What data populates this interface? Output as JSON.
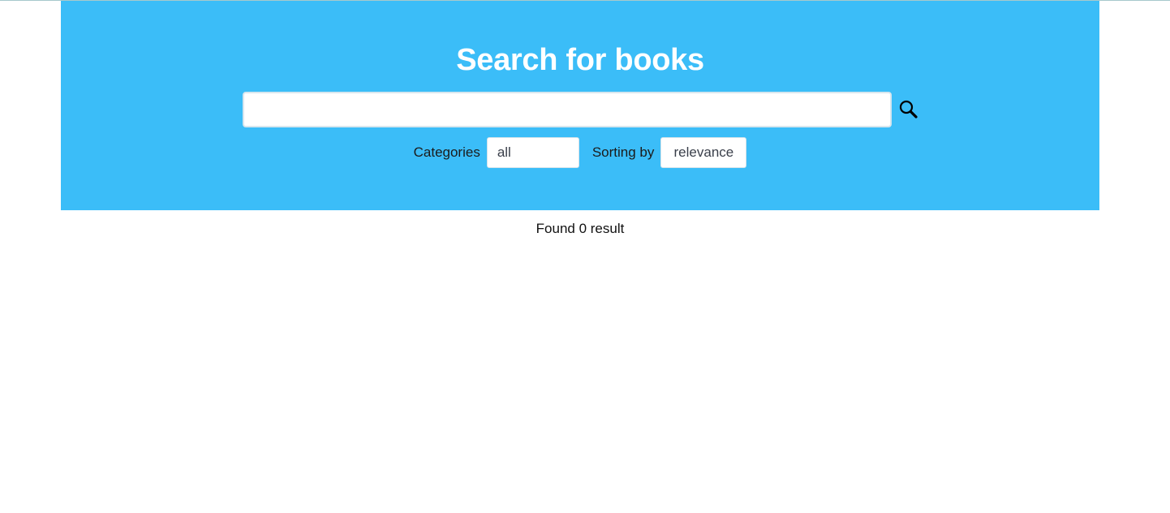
{
  "header": {
    "title": "Search for books",
    "background_color": "#3bbdf8"
  },
  "search": {
    "value": "",
    "placeholder": "",
    "button_icon": "search-icon"
  },
  "filters": {
    "categories_label": "Categories",
    "categories_value": "all",
    "sorting_label": "Sorting by",
    "sorting_value": "relevance"
  },
  "results": {
    "summary": "Found 0 result"
  }
}
